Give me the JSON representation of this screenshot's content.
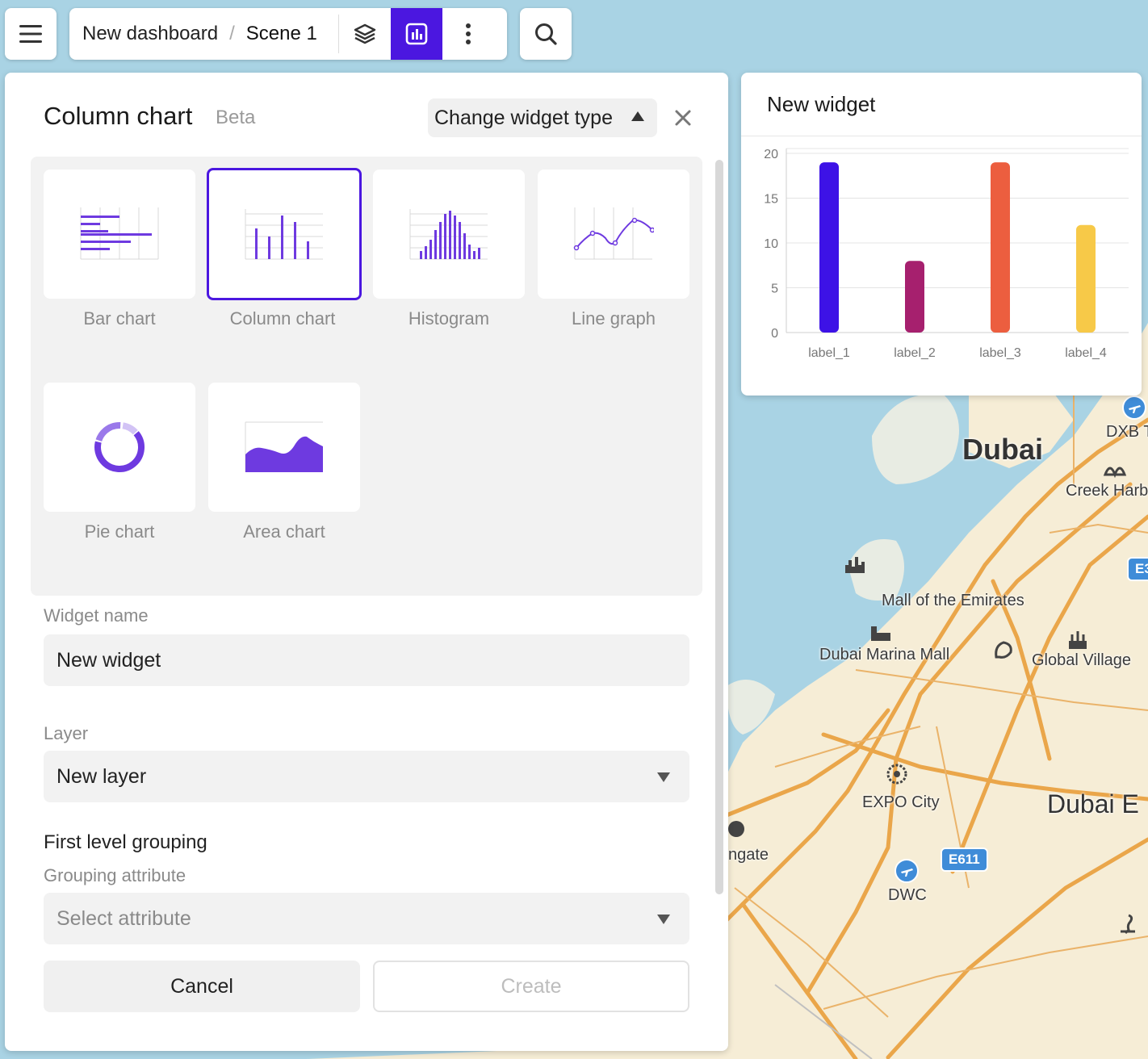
{
  "topbar": {
    "breadcrumb_dashboard": "New dashboard",
    "breadcrumb_separator": "/",
    "breadcrumb_scene": "Scene 1",
    "accent_color": "#4b17e0"
  },
  "panel": {
    "title": "Column chart",
    "badge": "Beta",
    "change_type_label": "Change widget type",
    "chart_types": [
      {
        "label": "Bar chart",
        "icon": "bar-chart-icon"
      },
      {
        "label": "Column chart",
        "icon": "column-chart-icon",
        "selected": true
      },
      {
        "label": "Histogram",
        "icon": "histogram-icon"
      },
      {
        "label": "Line graph",
        "icon": "line-graph-icon"
      },
      {
        "label": "Pie chart",
        "icon": "pie-chart-icon"
      },
      {
        "label": "Area chart",
        "icon": "area-chart-icon"
      }
    ],
    "widget_name_label": "Widget name",
    "widget_name_value": "New widget",
    "layer_label": "Layer",
    "layer_value": "New layer",
    "grouping_title": "First level grouping",
    "grouping_attribute_label": "Grouping attribute",
    "grouping_attribute_placeholder": "Select attribute",
    "cancel_label": "Cancel",
    "create_label": "Create"
  },
  "widget": {
    "title": "New widget"
  },
  "chart_data": {
    "type": "bar",
    "categories": [
      "label_1",
      "label_2",
      "label_3",
      "label_4"
    ],
    "values": [
      19,
      8,
      19,
      12
    ],
    "colors": [
      "#3d12e6",
      "#a6206e",
      "#ec5e3f",
      "#f7c948"
    ],
    "ylim": [
      0,
      20
    ],
    "yticks": [
      0,
      5,
      10,
      15,
      20
    ],
    "grid": true,
    "title": "",
    "xlabel": "",
    "ylabel": ""
  },
  "map": {
    "labels": {
      "dubai": "Dubai",
      "dxb": "DXB T",
      "creek_harbour": "Creek Harb",
      "mall_emirates": "Mall of the Emirates",
      "marina_mall": "Dubai Marina Mall",
      "global_village": "Global Village",
      "expo_city": "EXPO City",
      "dubai_e": "Dubai E",
      "ngate": "ngate",
      "dwc": "DWC",
      "e611": "E611",
      "e3": "E3"
    }
  }
}
